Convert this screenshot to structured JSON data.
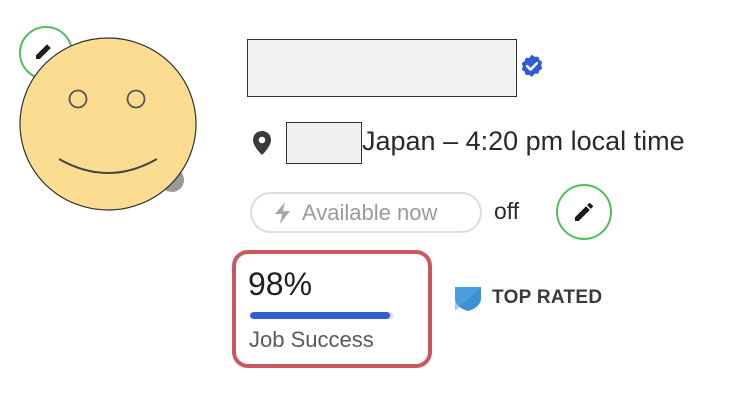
{
  "profile": {
    "location_text": "Japan – 4:20 pm local time"
  },
  "availability": {
    "label": "Available now",
    "state": "off"
  },
  "job_success": {
    "value": "98%",
    "percent": 98,
    "label": "Job Success"
  },
  "badge": {
    "label": "TOP RATED"
  },
  "colors": {
    "accent_green": "#4fbf5b",
    "progress_blue": "#2f5fd0",
    "highlight_red": "#c9595f",
    "badge_blue": "#3d8fd6"
  },
  "icons": {
    "verified": "verified-check-icon",
    "location": "map-pin-icon",
    "availability": "lightning-bolt-icon",
    "edit": "pencil-icon",
    "badge": "top-rated-shield-icon"
  }
}
